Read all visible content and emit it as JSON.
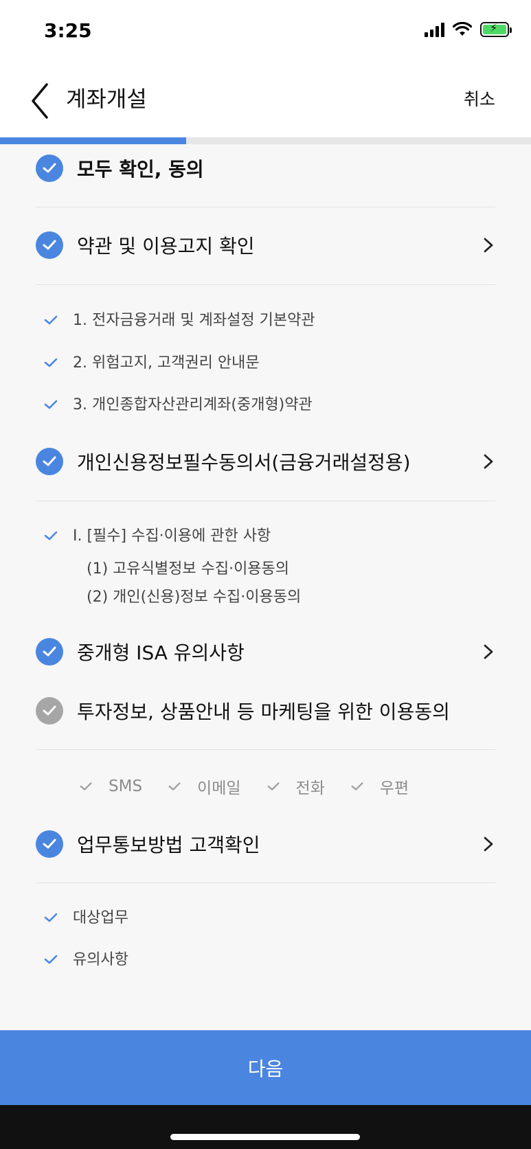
{
  "status": {
    "time": "3:25"
  },
  "header": {
    "title": "계좌개설",
    "cancel": "취소"
  },
  "progress": {
    "fraction": 0.35
  },
  "agree_all": {
    "label": "모두 확인, 동의",
    "checked": true
  },
  "sections": [
    {
      "label": "약관 및 이용고지 확인",
      "checked": true,
      "has_chevron": true,
      "items": [
        "1. 전자금융거래 및 계좌설정 기본약관",
        "2. 위험고지, 고객권리 안내문",
        "3. 개인종합자산관리계좌(중개형)약관"
      ]
    },
    {
      "label": "개인신용정보필수동의서(금융거래설정용)",
      "checked": true,
      "has_chevron": true,
      "items": [
        "I. [필수] 수집·이용에 관한 사항"
      ],
      "sub_items": [
        "(1) 고유식별정보 수집·이용동의",
        "(2) 개인(신용)정보 수집·이용동의"
      ]
    },
    {
      "label": "중개형 ISA 유의사항",
      "checked": true,
      "has_chevron": true
    },
    {
      "label": "투자정보, 상품안내 등 마케팅을 위한 이용동의",
      "checked": false,
      "has_chevron": false,
      "channels": [
        "SMS",
        "이메일",
        "전화",
        "우편"
      ]
    },
    {
      "label": "업무통보방법 고객확인",
      "checked": true,
      "has_chevron": true,
      "items": [
        "대상업무",
        "유의사항"
      ]
    }
  ],
  "next_button": {
    "label": "다음"
  },
  "colors": {
    "accent": "#4a86e0",
    "unchecked": "#a6a6a6",
    "channel_gray": "#8c8c8c"
  }
}
